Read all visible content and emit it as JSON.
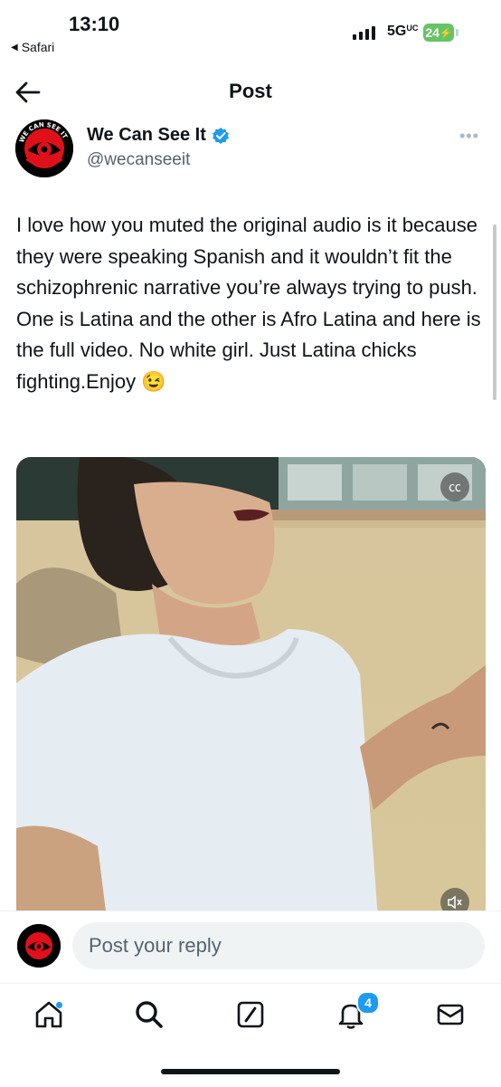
{
  "status_bar": {
    "time": "13:10",
    "back_app": "Safari",
    "network": "5G",
    "network_suffix": "UC",
    "battery": "24"
  },
  "header": {
    "title": "Post"
  },
  "tweet": {
    "author_name": "We Can See It",
    "author_handle": "@wecanseeit",
    "text": "I love how you muted the original audio is it because they were speaking Spanish and it wouldn’t fit the schizophrenic narrative you’re always trying to push. One is Latina and the other is Afro Latina and here is the full video. No white girl. Just Latina chicks fighting.Enjoy 😉"
  },
  "avatar_logo": {
    "text": "WE CAN SEE IT"
  },
  "reply": {
    "placeholder": "Post your reply"
  },
  "tab_bar": {
    "notification_count": "4"
  },
  "colors": {
    "accent": "#1d9bf0",
    "text": "#0f1419",
    "secondary_text": "#536471",
    "battery": "#65c466"
  }
}
